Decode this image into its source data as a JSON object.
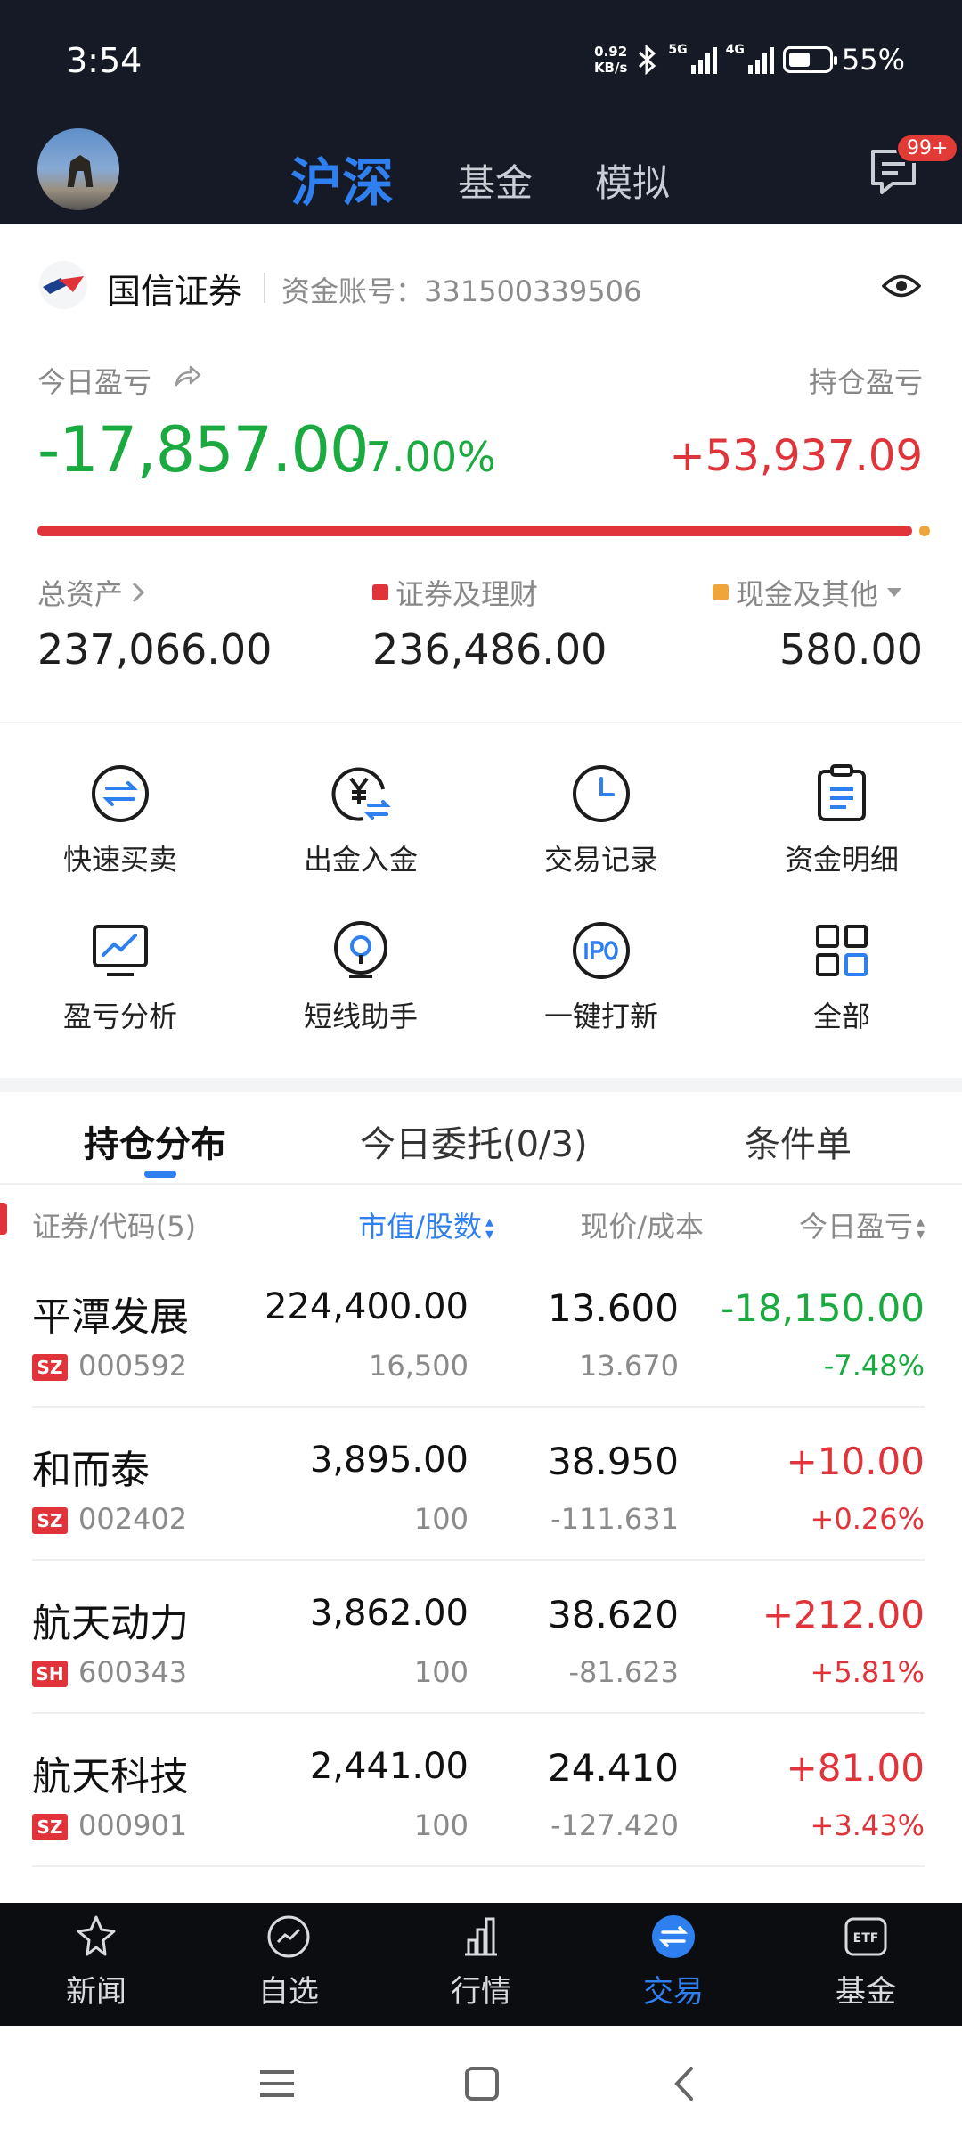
{
  "status_bar": {
    "time": "3:54",
    "net_speed_value": "0.92",
    "net_speed_unit": "KB/s",
    "net_type_1": "5G",
    "net_type_2": "4G",
    "battery_percent": "55%",
    "battery_level": 0.55
  },
  "header": {
    "tabs": [
      {
        "label": "沪深",
        "active": true
      },
      {
        "label": "基金",
        "active": false
      },
      {
        "label": "模拟",
        "active": false
      }
    ],
    "message_badge": "99+"
  },
  "account": {
    "broker_name": "国信证券",
    "account_label": "资金账号：331500339506"
  },
  "summary": {
    "today_pnl_label": "今日盈亏",
    "today_pnl_value": "-17,857.00",
    "today_pnl_pct": "-7.00%",
    "position_pnl_label": "持仓盈亏",
    "position_pnl_value": "+53,937.09",
    "securities_share": 0.9976,
    "total_assets_label": "总资产",
    "total_assets_value": "237,066.00",
    "securities_label": "证券及理财",
    "securities_value": "236,486.00",
    "cash_label": "现金及其他",
    "cash_value": "580.00",
    "colors": {
      "securities": "#e0333a",
      "cash": "#f0a53a",
      "loss": "#1aaa3f",
      "gain": "#e0333a",
      "accent": "#2e7ff0"
    }
  },
  "quick_actions": [
    {
      "label": "快速买卖",
      "icon": "exchange-icon"
    },
    {
      "label": "出金入金",
      "icon": "yuan-transfer-icon"
    },
    {
      "label": "交易记录",
      "icon": "clock-icon"
    },
    {
      "label": "资金明细",
      "icon": "clipboard-icon"
    },
    {
      "label": "盈亏分析",
      "icon": "chart-monitor-icon"
    },
    {
      "label": "短线助手",
      "icon": "target-icon"
    },
    {
      "label": "一键打新",
      "icon": "ipo-icon"
    },
    {
      "label": "全部",
      "icon": "grid-icon"
    }
  ],
  "holdings_tabs": [
    {
      "label": "持仓分布",
      "active": true
    },
    {
      "label": "今日委托(0/3)",
      "active": false
    },
    {
      "label": "条件单",
      "active": false
    }
  ],
  "table_headers": {
    "security": "证券/代码(5)",
    "market_value": "市值/股数",
    "price_cost": "现价/成本",
    "today_pnl": "今日盈亏"
  },
  "holdings": [
    {
      "name": "平潭发展",
      "market": "SZ",
      "code": "000592",
      "market_value": "224,400.00",
      "shares": "16,500",
      "price": "13.600",
      "cost": "13.670",
      "pnl": "-18,150.00",
      "pnl_pct": "-7.48%",
      "direction": "down"
    },
    {
      "name": "和而泰",
      "market": "SZ",
      "code": "002402",
      "market_value": "3,895.00",
      "shares": "100",
      "price": "38.950",
      "cost": "-111.631",
      "pnl": "+10.00",
      "pnl_pct": "+0.26%",
      "direction": "up"
    },
    {
      "name": "航天动力",
      "market": "SH",
      "code": "600343",
      "market_value": "3,862.00",
      "shares": "100",
      "price": "38.620",
      "cost": "-81.623",
      "pnl": "+212.00",
      "pnl_pct": "+5.81%",
      "direction": "up"
    },
    {
      "name": "航天科技",
      "market": "SZ",
      "code": "000901",
      "market_value": "2,441.00",
      "shares": "100",
      "price": "24.410",
      "cost": "-127.420",
      "pnl": "+81.00",
      "pnl_pct": "+3.43%",
      "direction": "up"
    }
  ],
  "bottom_nav": [
    {
      "label": "新闻",
      "icon": "news-icon",
      "active": false
    },
    {
      "label": "自选",
      "icon": "watchlist-icon",
      "active": false
    },
    {
      "label": "行情",
      "icon": "market-bars-icon",
      "active": false
    },
    {
      "label": "交易",
      "icon": "trade-icon",
      "active": true
    },
    {
      "label": "基金",
      "icon": "etf-icon",
      "active": false
    }
  ]
}
